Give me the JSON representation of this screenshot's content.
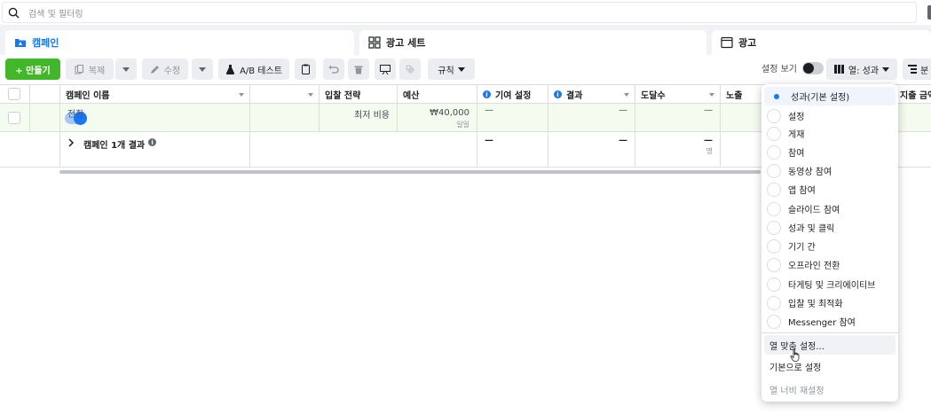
{
  "search": {
    "placeholder": "검색 및 필터링"
  },
  "tabs": [
    {
      "label": "캠페인"
    },
    {
      "label": "광고 세트"
    },
    {
      "label": "광고"
    }
  ],
  "toolbar": {
    "create_label": "+ 만들기",
    "duplicate_label": "복제",
    "edit_label": "수정",
    "ab_test_label": "A/B 테스트",
    "rules_label": "규칙",
    "view_settings_label": "설정 보기",
    "columns_label": "열: 성과",
    "breakdown_label": "분"
  },
  "table": {
    "headers": {
      "name": "캠페인 이름",
      "bid_strategy": "입찰 전략",
      "budget": "예산",
      "attribution": "기여 설정",
      "results": "결과",
      "reach": "도달수",
      "impressions": "노출",
      "spend": "지출 금액"
    },
    "row": {
      "name": "전환",
      "bid_strategy": "최저 비용",
      "budget": "₩40,000",
      "budget_period": "일일",
      "attribution": "—",
      "results": "—",
      "reach": "—"
    },
    "summary": {
      "label": "캠페인 1개 결과",
      "attribution": "—",
      "results": "—",
      "reach": "—",
      "reach_unit": "명"
    }
  },
  "columns_menu": {
    "presets": [
      "성과(기본 설정)",
      "설정",
      "게재",
      "참여",
      "동영상 참여",
      "앱 참여",
      "슬라이드 참여",
      "성과 및 클릭",
      "기기 간",
      "오프라인 전환",
      "타게팅 및 크리에이티브",
      "입찰 및 최적화",
      "Messenger 참여"
    ],
    "selected_index": 0,
    "customize_label": "열 맞춤 설정...",
    "set_default_label": "기본으로 설정",
    "reset_width_label": "열 너비 재설정"
  },
  "colors": {
    "accent": "#1877f2",
    "create_button": "#42b72a",
    "selected_row": "#f4fbef"
  }
}
